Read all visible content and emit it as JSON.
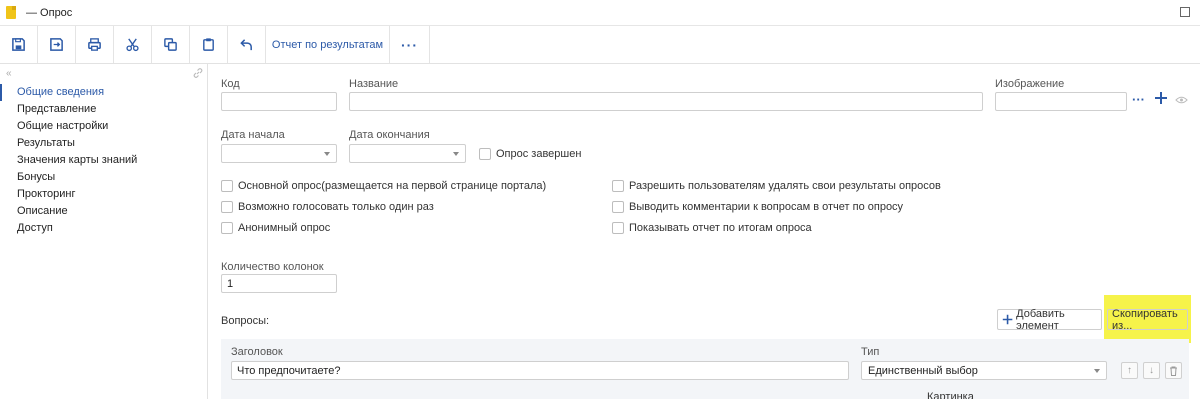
{
  "window": {
    "title": "— Опрос"
  },
  "toolbar": {
    "buttons": [
      "save-icon",
      "save-close-icon",
      "print-icon",
      "cut-icon",
      "copy-icon",
      "paste-icon",
      "undo-icon"
    ],
    "report_label": "Отчет по результатам",
    "more_label": "···"
  },
  "sidebar": {
    "collapse_label": "«",
    "items": [
      {
        "label": "Общие сведения",
        "active": true
      },
      {
        "label": "Представление"
      },
      {
        "label": "Общие настройки"
      },
      {
        "label": "Результаты"
      },
      {
        "label": "Значения карты знаний"
      },
      {
        "label": "Бонусы"
      },
      {
        "label": "Прокторинг"
      },
      {
        "label": "Описание"
      },
      {
        "label": "Доступ"
      }
    ]
  },
  "form": {
    "code_label": "Код",
    "code_value": "",
    "name_label": "Название",
    "name_value": "",
    "image_label": "Изображение",
    "image_value": "",
    "image_more": "···",
    "start_date_label": "Дата начала",
    "end_date_label": "Дата окончания",
    "completed_label": "Опрос завершен",
    "checkboxes_left": [
      "Основной опрос(размещается на первой странице портала)",
      "Возможно голосовать только один раз",
      "Анонимный опрос"
    ],
    "checkboxes_right": [
      "Разрешить пользователям удалять свои результаты опросов",
      "Выводить комментарии к вопросам в отчет по опросу",
      "Показывать отчет по итогам опроса"
    ],
    "columns_label": "Количество колонок",
    "columns_value": "1"
  },
  "questions": {
    "label": "Вопросы:",
    "add_label": "Добавить элемент",
    "copy_label": "Скопировать из...",
    "header_title": "Заголовок",
    "header_type": "Тип",
    "row_title": "Что предпочитаете?",
    "row_type": "Единственный выбор",
    "picture_label": "Картинка",
    "up_label": "↑",
    "down_label": "↓"
  },
  "colors": {
    "accent": "#2c5aa8",
    "highlight": "#f6f34a"
  }
}
